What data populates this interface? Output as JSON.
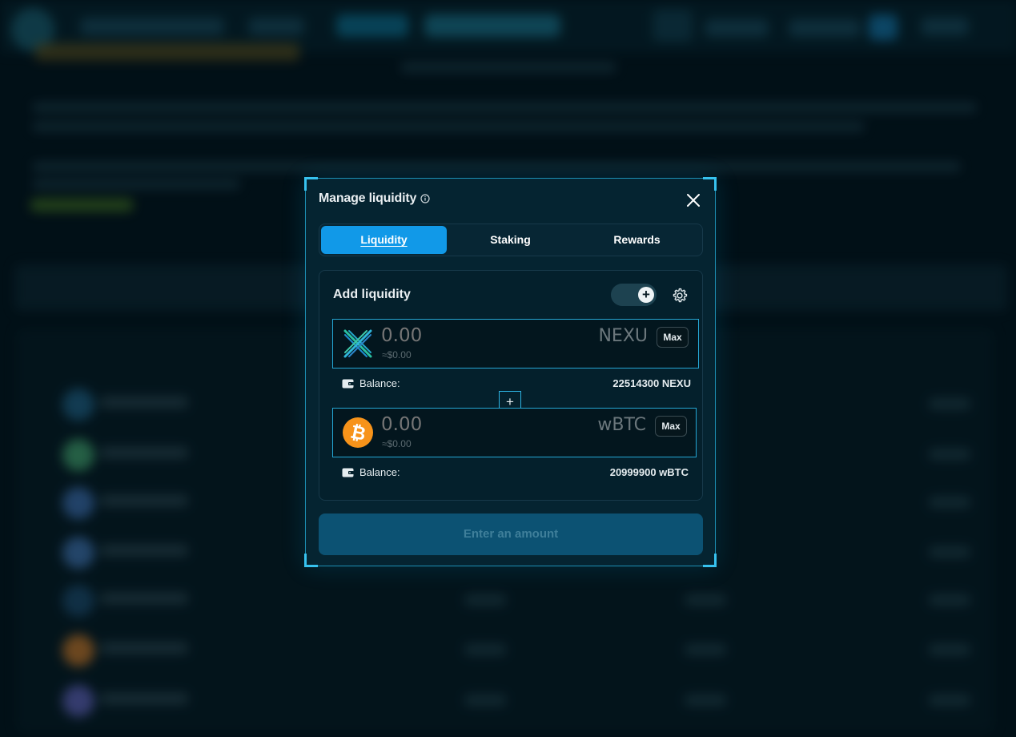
{
  "modal": {
    "title": "Manage liquidity",
    "tabs": [
      {
        "label": "Liquidity",
        "active": true
      },
      {
        "label": "Staking",
        "active": false
      },
      {
        "label": "Rewards",
        "active": false
      }
    ],
    "add_liquidity": {
      "title": "Add liquidity",
      "toggle_on": true,
      "token_a": {
        "symbol": "NEXU",
        "amount_placeholder": "0.00",
        "usd_value": "≈$0.00",
        "max_label": "Max",
        "balance_label": "Balance:",
        "balance_value": "22514300 NEXU"
      },
      "token_b": {
        "symbol": "wBTC",
        "amount_placeholder": "0.00",
        "usd_value": "≈$0.00",
        "max_label": "Max",
        "balance_label": "Balance:",
        "balance_value": "20999900 wBTC"
      }
    },
    "submit_label": "Enter an amount"
  },
  "icons": {
    "info": "info-icon",
    "close": "close-icon",
    "settings": "gear-icon",
    "wallet": "wallet-icon",
    "plus": "plus-icon",
    "token_a_logo": "nexu-logo",
    "token_b_logo": "bitcoin-logo"
  },
  "colors": {
    "accent": "#1199e8",
    "frame": "#25a6d4",
    "modal_bg": "#052431",
    "bitcoin": "#f7931a",
    "submit_bg": "#0c5273"
  }
}
